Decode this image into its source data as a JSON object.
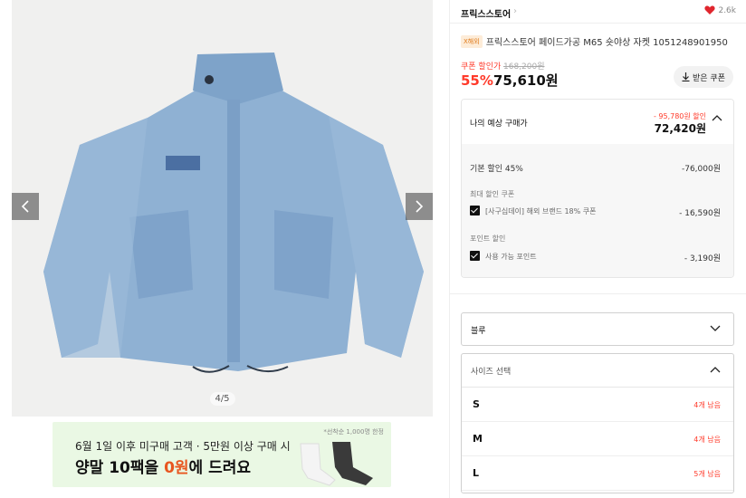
{
  "gallery": {
    "counter": "4/5",
    "prev_icon": "chevron-left-icon",
    "next_icon": "chevron-right-icon"
  },
  "banner": {
    "line1": "6월 1일 이후 미구매 고객 · 5만원 이상 구매 시",
    "line2_pre": "양말 10팩을 ",
    "line2_highlight": "0원",
    "line2_post": "에 드려요",
    "note": "*선착순 1,000명 한정",
    "highlight_color": "#e8561f"
  },
  "product": {
    "brand": "프릭스스토어",
    "likes": "2.6k",
    "badge": "X해외",
    "title": "프릭스스토어 페이드가공 M65 숏야상 자켓 1051248901950",
    "coupon_label": "쿠폰 할인가",
    "original_price": "168,200원",
    "discount_pct": "55%",
    "sale_price": "75,610원",
    "download_coupon": "받은 쿠폰",
    "accent_color": "#ff3a2a"
  },
  "expected": {
    "label": "나의 예상 구매가",
    "total_discount": "- 95,780원 할인",
    "final_price": "72,420원",
    "base_discount_label": "기본 할인 45%",
    "base_discount_amt": "-76,000원",
    "max_coupon_title": "최대 할인 쿠폰",
    "coupon_item": "[사구십데이] 해외 브랜드 18% 쿠폰",
    "coupon_amt": "- 16,590원",
    "point_title": "포인트 할인",
    "point_item": "사용 가능 포인트",
    "point_amt": "- 3,190원"
  },
  "options": {
    "color_value": "블루",
    "size_placeholder": "사이즈 선택",
    "sizes": [
      {
        "name": "S",
        "stock": "4개 남음"
      },
      {
        "name": "M",
        "stock": "4개 남음"
      },
      {
        "name": "L",
        "stock": "5개 남음"
      }
    ]
  }
}
